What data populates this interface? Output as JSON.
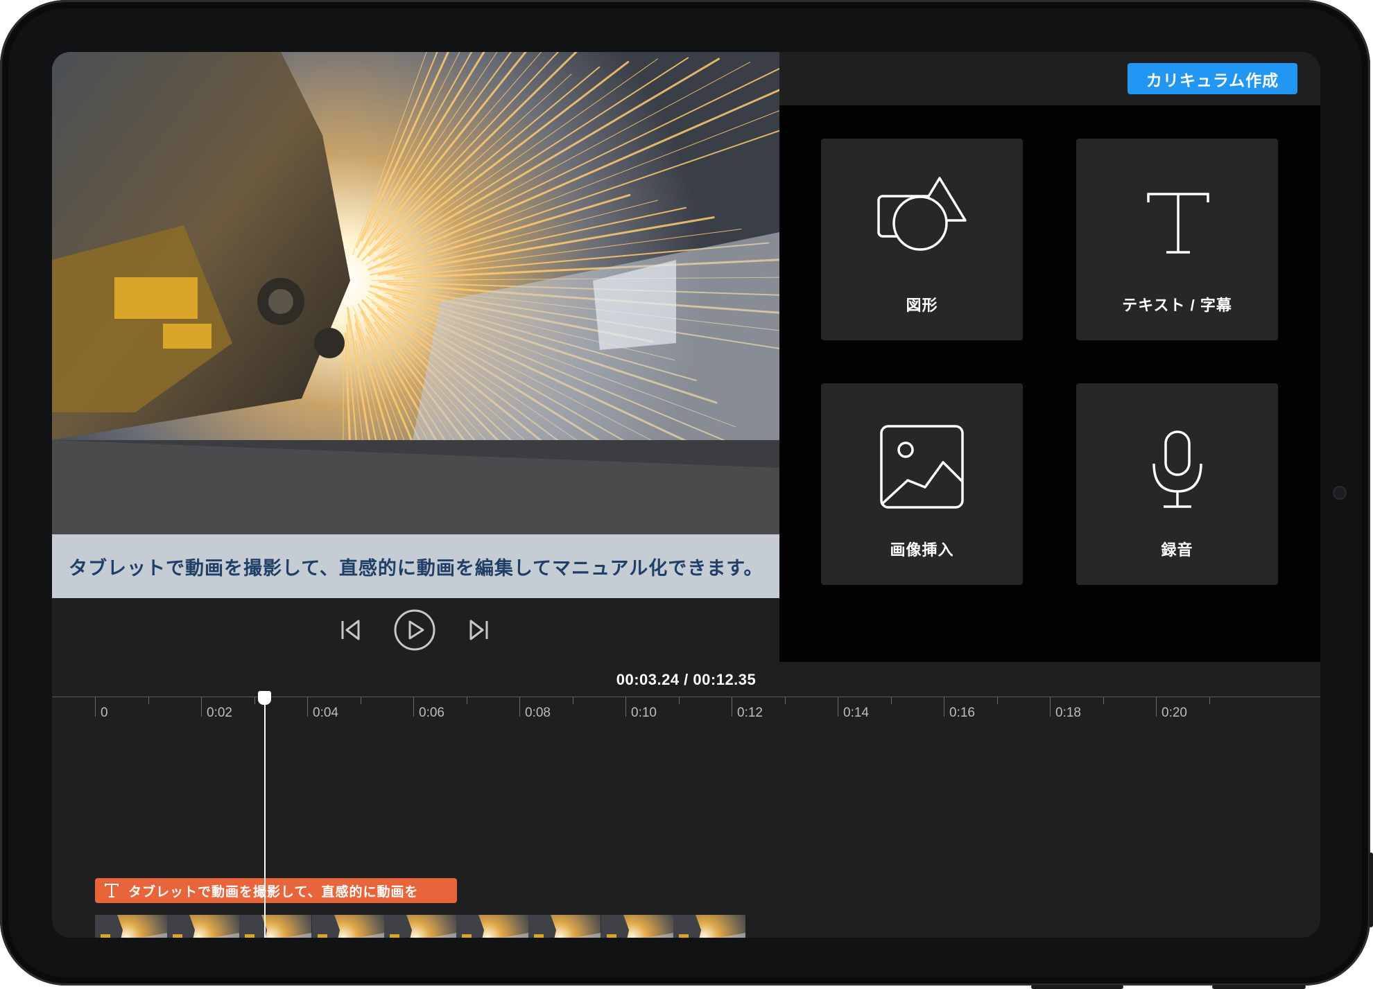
{
  "curriculum_button": "カリキュラム作成",
  "video": {
    "caption": "タブレットで動画を撮影して、直感的に動画を編集してマニュアル化できます。"
  },
  "player": {
    "prev_icon": "skip-back-icon",
    "play_icon": "play-icon",
    "next_icon": "skip-forward-icon"
  },
  "tools": [
    {
      "label": "図形",
      "icon": "shapes-icon"
    },
    {
      "label": "テキスト / 字幕",
      "icon": "text-icon"
    },
    {
      "label": "画像挿入",
      "icon": "image-icon"
    },
    {
      "label": "録音",
      "icon": "microphone-icon"
    }
  ],
  "timeline": {
    "current_time": "00:03.24",
    "total_time": "00:12.35",
    "time_readout": "00:03.24 / 00:12.35",
    "ticks": [
      "0",
      "0:02",
      "0:04",
      "0:06",
      "0:08",
      "0:10",
      "0:12",
      "0:14",
      "0:16",
      "0:18",
      "0:20"
    ],
    "text_clip": {
      "icon": "text-icon",
      "label": "タブレットで動画を撮影して、直感的に動画を"
    },
    "video_clip_frames": 9
  },
  "colors": {
    "accent_blue": "#2196f3",
    "clip_orange": "#e8643a",
    "panel_dark": "#1f1f20",
    "tile": "#272728"
  }
}
